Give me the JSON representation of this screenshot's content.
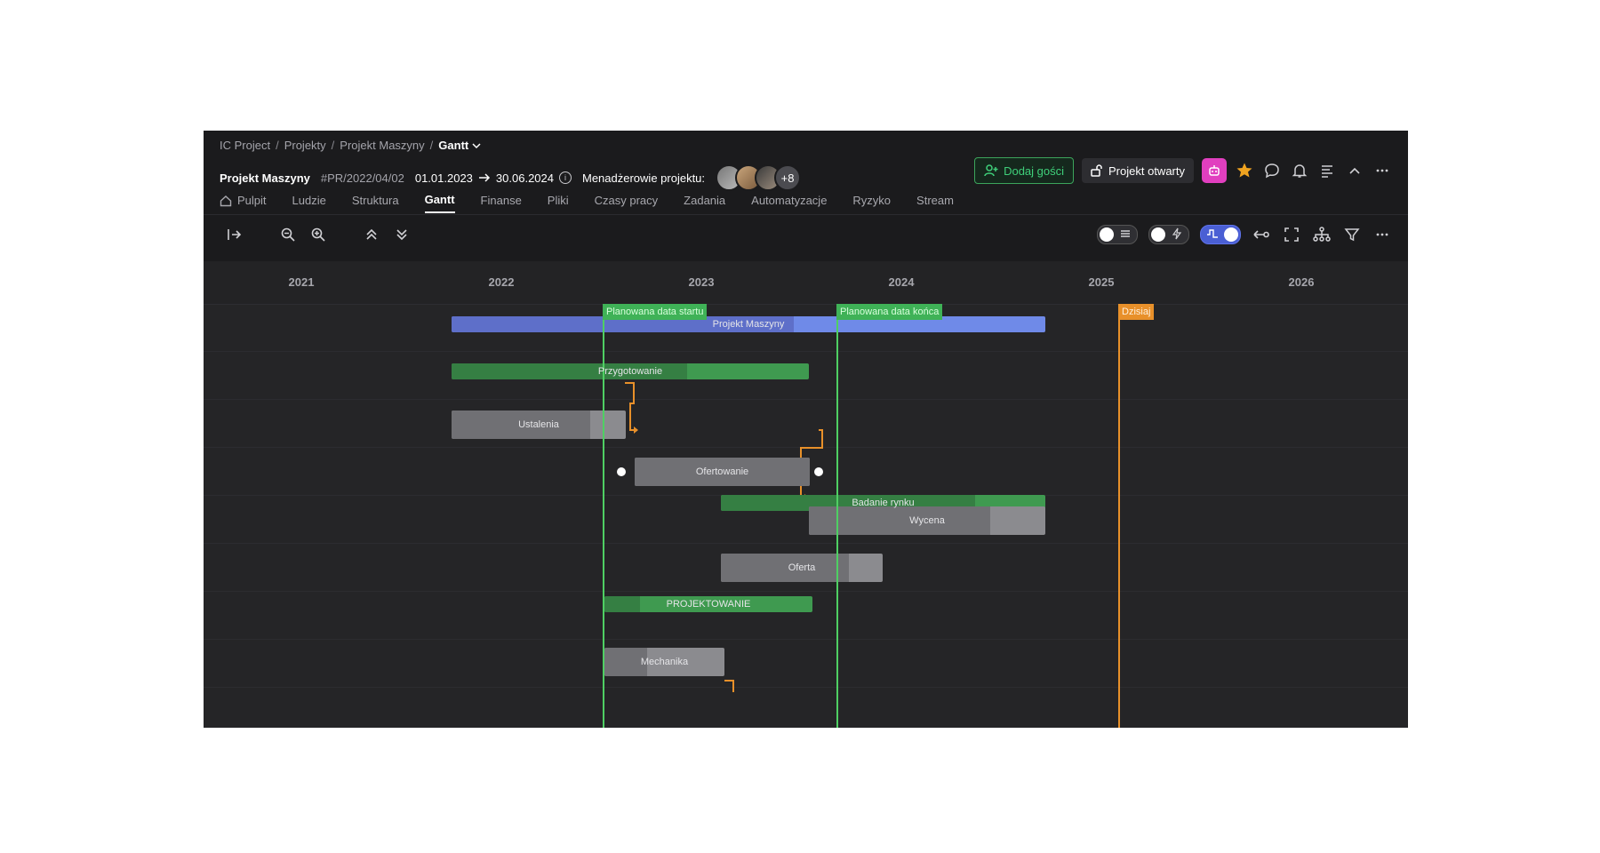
{
  "breadcrumb": {
    "items": [
      "IC Project",
      "Projekty",
      "Projekt Maszyny"
    ],
    "current": "Gantt"
  },
  "project": {
    "name": "Projekt Maszyny",
    "code": "#PR/2022/04/02",
    "start": "01.01.2023",
    "end": "30.06.2024",
    "managers_label": "Menadżerowie projektu:",
    "more_managers": "+8"
  },
  "actions": {
    "add_guests": "Dodaj gości",
    "project_open": "Projekt otwarty"
  },
  "tabs": [
    "Pulpit",
    "Ludzie",
    "Struktura",
    "Gantt",
    "Finanse",
    "Pliki",
    "Czasy pracy",
    "Zadania",
    "Automatyzacje",
    "Ryzyko",
    "Stream"
  ],
  "active_tab": "Gantt",
  "timeline": {
    "years": [
      "2021",
      "2022",
      "2023",
      "2024",
      "2025",
      "2026"
    ]
  },
  "markers": {
    "planned_start": "Planowana data startu",
    "planned_end": "Planowana data końca",
    "today": "Dzisiaj"
  },
  "tasks": {
    "projekt_maszyny": "Projekt Maszyny",
    "przygotowanie": "Przygotowanie",
    "ustalenia": "Ustalenia",
    "ofertowanie": "Ofertowanie",
    "badanie_rynku": "Badanie rynku",
    "wycena": "Wycena",
    "oferta": "Oferta",
    "projektowanie": "PROJEKTOWANIE",
    "mechanika": "Mechanika"
  },
  "colors": {
    "summary_blue": "#6f8ae8",
    "summary_green": "#3f9a50",
    "planned_line": "#4fcf63",
    "today_line": "#e8902a",
    "dependency": "#e8902a"
  }
}
